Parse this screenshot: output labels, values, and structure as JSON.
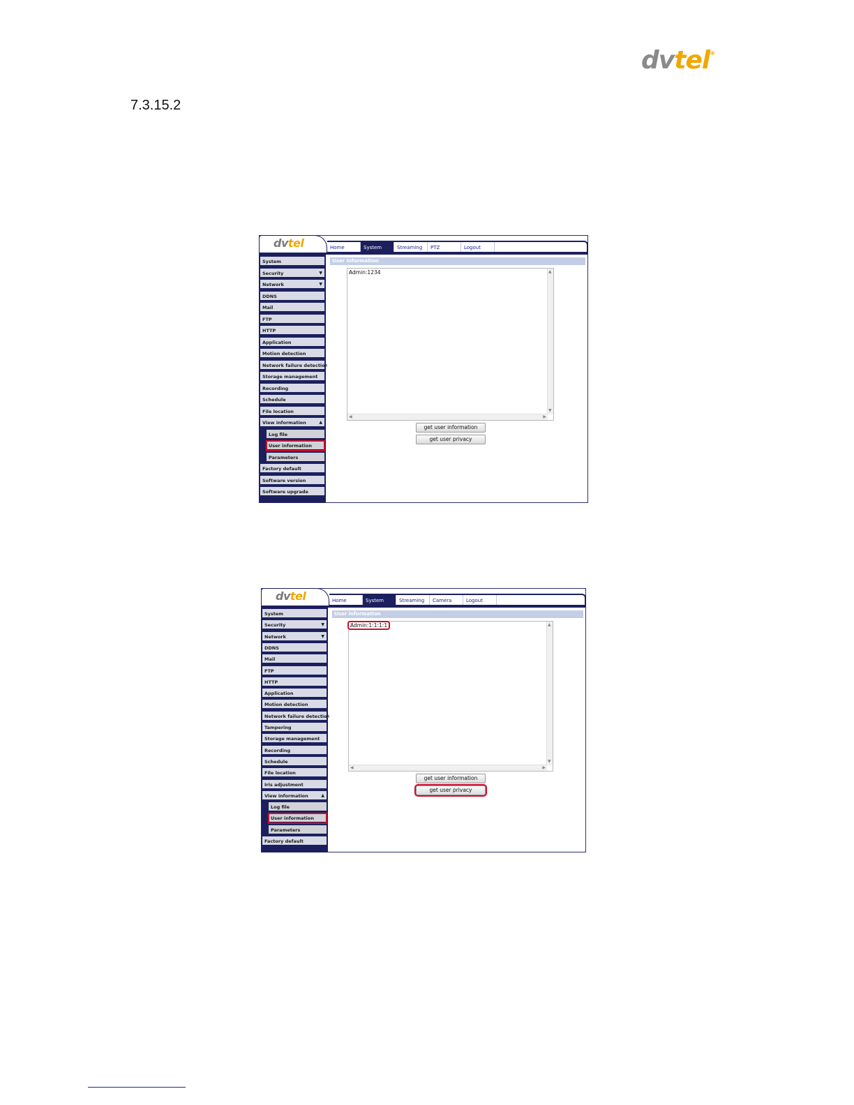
{
  "header": {
    "logo_dv": "dv",
    "logo_tel": "tel",
    "logo_mark": "®",
    "section_number": "7.3.15.2"
  },
  "screenshot1": {
    "logo_dv": "dv",
    "logo_tel": "tel",
    "tabs": [
      "Home",
      "System",
      "Streaming",
      "PTZ",
      "Logout"
    ],
    "active_tab": "System",
    "menu": [
      {
        "label": "System"
      },
      {
        "label": "Security",
        "arrow": "▼"
      },
      {
        "label": "Network",
        "arrow": "▼"
      },
      {
        "label": "DDNS"
      },
      {
        "label": "Mail"
      },
      {
        "label": "FTP"
      },
      {
        "label": "HTTP"
      },
      {
        "label": "Application"
      },
      {
        "label": "Motion detection"
      },
      {
        "label": "Network failure detection"
      },
      {
        "label": "Storage management"
      },
      {
        "label": "Recording"
      },
      {
        "label": "Schedule"
      },
      {
        "label": "File location"
      },
      {
        "label": "View information",
        "arrow": "▲"
      },
      {
        "label": "Log file",
        "sub": true
      },
      {
        "label": "User information",
        "sub": true,
        "highlighted": true
      },
      {
        "label": "Parameters",
        "sub": true
      },
      {
        "label": "Factory default"
      },
      {
        "label": "Software version"
      },
      {
        "label": "Software upgrade"
      }
    ],
    "content_title": "User information",
    "info_text": "Admin:1234",
    "buttons": [
      "get user information",
      "get user privacy"
    ],
    "highlight_color": "#c8102e",
    "nav_color": "#1c1f5e"
  },
  "screenshot2": {
    "logo_dv": "dv",
    "logo_tel": "tel",
    "tabs": [
      "Home",
      "System",
      "Streaming",
      "Camera",
      "Logout"
    ],
    "active_tab": "System",
    "menu": [
      {
        "label": "System"
      },
      {
        "label": "Security",
        "arrow": "▼"
      },
      {
        "label": "Network",
        "arrow": "▼"
      },
      {
        "label": "DDNS"
      },
      {
        "label": "Mail"
      },
      {
        "label": "FTP"
      },
      {
        "label": "HTTP"
      },
      {
        "label": "Application"
      },
      {
        "label": "Motion detection"
      },
      {
        "label": "Network failure detection"
      },
      {
        "label": "Tampering"
      },
      {
        "label": "Storage management"
      },
      {
        "label": "Recording"
      },
      {
        "label": "Schedule"
      },
      {
        "label": "File location"
      },
      {
        "label": "Iris adjustment"
      },
      {
        "label": "View information",
        "arrow": "▲"
      },
      {
        "label": "Log file",
        "sub": true
      },
      {
        "label": "User information",
        "sub": true,
        "highlighted": true
      },
      {
        "label": "Parameters",
        "sub": true
      },
      {
        "label": "Factory default"
      }
    ],
    "content_title": "User information",
    "info_text": "Admin:1:1:1:1",
    "buttons": [
      "get user information",
      "get user privacy"
    ],
    "highlighted_button": "get user privacy"
  }
}
